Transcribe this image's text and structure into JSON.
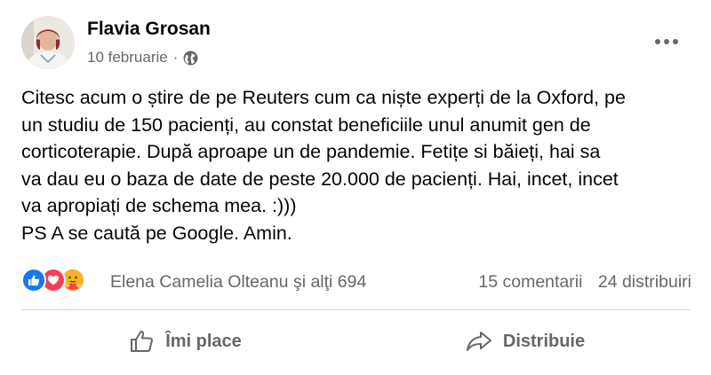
{
  "post": {
    "author": "Flavia Grosan",
    "date": "10 februarie",
    "meta_separator": "·",
    "visibility_icon": "globe-icon",
    "more_icon": "more-options-icon",
    "text_lines": [
      "Citesc acum o știre de pe Reuters cum ca niște experți de la Oxford, pe",
      "un studiu de 150 pacienți, au constat beneficiile unul anumit gen de",
      "corticoterapie. După aproape un de pandemie. Fetițe si băieți, hai sa",
      "va dau eu o baza de date de peste 20.000 de pacienți. Hai, incet, incet",
      "va apropiați de schema mea. :)))",
      "PS A se caută pe Google. Amin."
    ]
  },
  "reactions": {
    "icons": [
      "like-reaction-icon",
      "love-reaction-icon",
      "care-reaction-icon"
    ],
    "names": "Elena Camelia Olteanu şi alţi 694",
    "comments": "15 comentarii",
    "shares": "24 distribuiri"
  },
  "actions": {
    "like_label": "Îmi place",
    "share_label": "Distribuie"
  },
  "colors": {
    "text": "#050505",
    "secondary_text": "#65676b",
    "like_blue": "#1877f2",
    "love_red": "#f33e58",
    "care_yellow": "#f7b125",
    "divider": "#ced0d4"
  }
}
